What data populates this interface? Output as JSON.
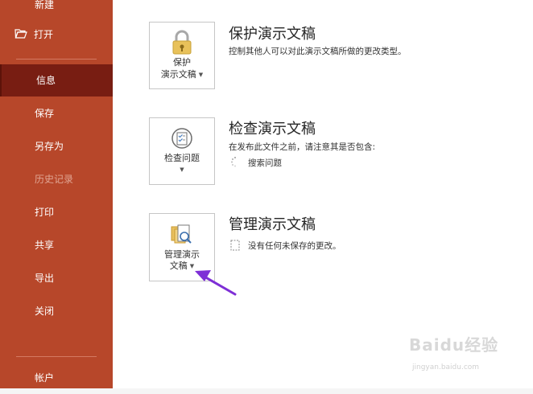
{
  "sidebar": {
    "items": [
      {
        "label": "新建"
      },
      {
        "label": "打开"
      },
      {
        "label": "信息"
      },
      {
        "label": "保存"
      },
      {
        "label": "另存为"
      },
      {
        "label": "历史记录"
      },
      {
        "label": "打印"
      },
      {
        "label": "共享"
      },
      {
        "label": "导出"
      },
      {
        "label": "关闭"
      },
      {
        "label": "帐户"
      }
    ]
  },
  "sections": {
    "protect": {
      "tile_line1": "保护",
      "tile_line2": "演示文稿",
      "title": "保护演示文稿",
      "description": "控制其他人可以对此演示文稿所做的更改类型。"
    },
    "inspect": {
      "tile_label": "检查问题",
      "title": "检查演示文稿",
      "description": "在发布此文件之前，请注意其是否包含:",
      "sub_item": "搜索问题"
    },
    "manage": {
      "tile_line1": "管理演示",
      "tile_line2": "文稿",
      "title": "管理演示文稿",
      "sub_item": "没有任何未保存的更改。"
    }
  },
  "watermark": {
    "main": "Baidu经验",
    "sub": "jingyan.baidu.com"
  },
  "colors": {
    "sidebar": "#b7472a",
    "sidebar_active": "#781d12",
    "arrow": "#7e2fd6"
  }
}
